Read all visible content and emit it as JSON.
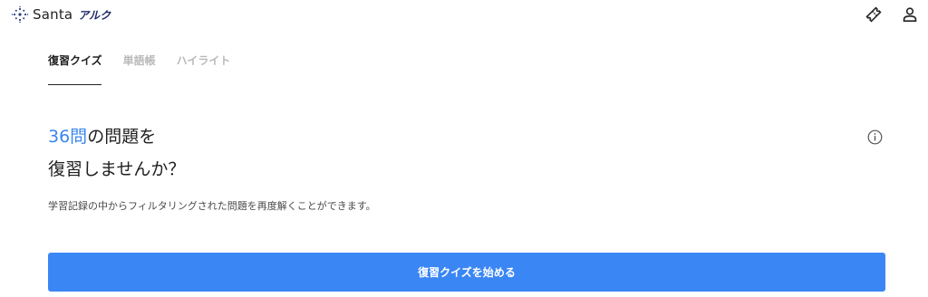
{
  "brand": {
    "name": "Santa",
    "sub": "アルク"
  },
  "header": {
    "ticket_icon": "ticket-icon",
    "profile_icon": "user-icon"
  },
  "tabs": [
    {
      "label": "復習クイズ",
      "active": true
    },
    {
      "label": "単語帳",
      "active": false
    },
    {
      "label": "ハイライト",
      "active": false
    }
  ],
  "main": {
    "count": "36問",
    "headline_rest": "の問題を",
    "headline_line2": "復習しませんか？",
    "description": "学習記録の中からフィルタリングされた問題を再度解くことができます。",
    "info_icon": "info-icon",
    "cta_label": "復習クイズを始める"
  },
  "colors": {
    "accent": "#3b86f5",
    "headline_count": "#3b86f0",
    "brand_sub": "#1d2a6b"
  }
}
